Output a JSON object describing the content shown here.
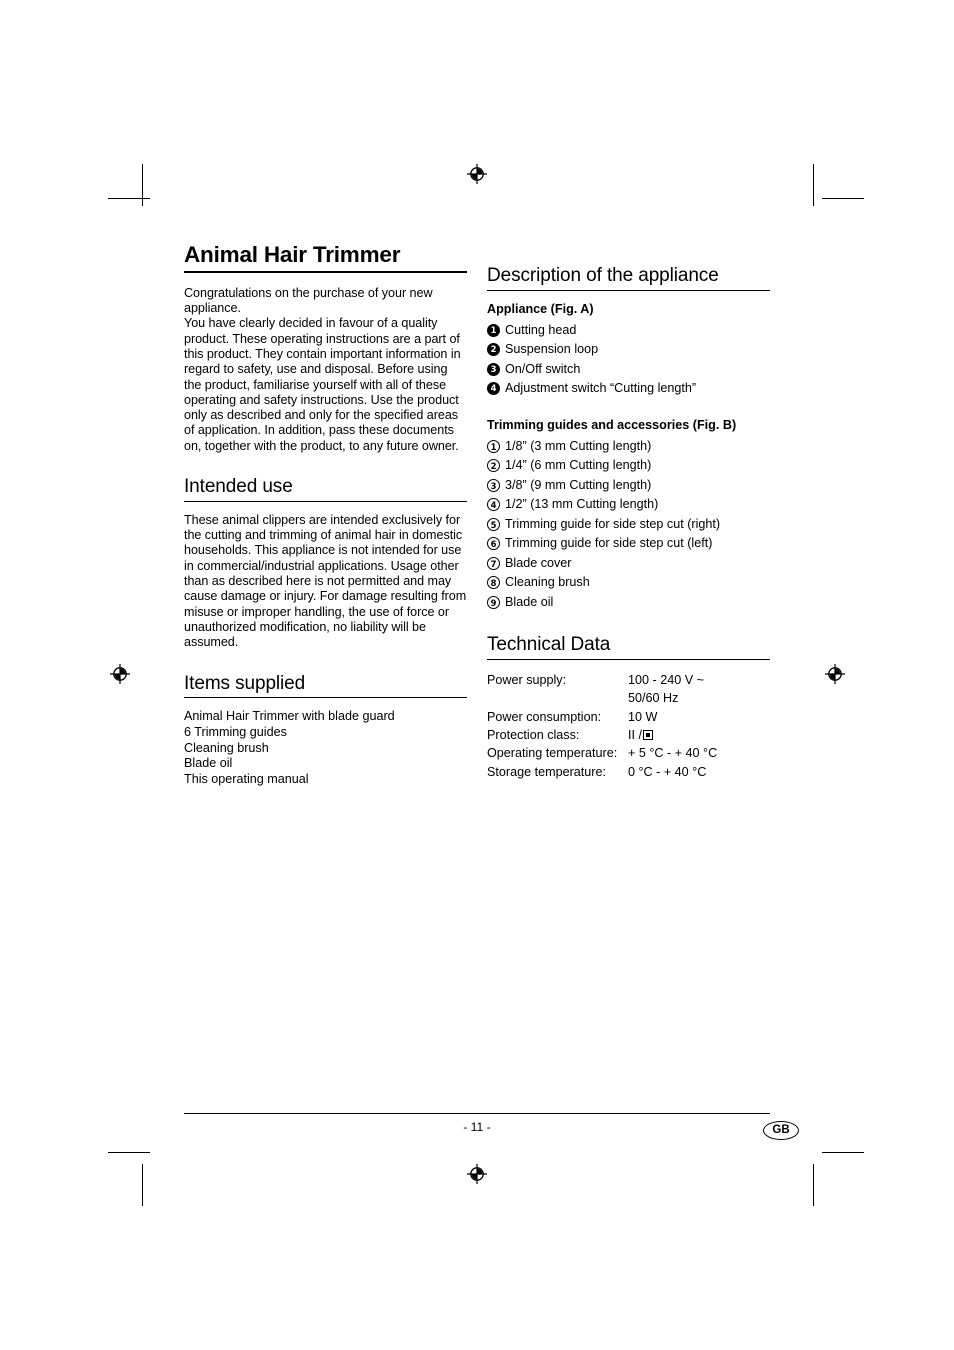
{
  "document": {
    "title": "Animal Hair Trimmer",
    "page_number": "- 11 -",
    "language_badge": "GB"
  },
  "left_column": {
    "intro": "Congratulations on the purchase of your new appliance.\nYou have clearly decided in favour of a quality product. These operating instructions are a part of this product. They contain important information in regard to safety, use and disposal. Before using the product, familiarise yourself with all of these operating and safety instructions. Use the product only as described and only for the specified areas of application. In addition, pass these documents on, together with the product, to any future owner.",
    "intended_use": {
      "heading": "Intended use",
      "text": "These animal clippers are intended exclusively for the cutting and trimming of animal hair in domestic households. This appliance is not intended for use in commercial/industrial applications. Usage other than as described here is not permitted and may cause damage or injury. For damage resulting from misuse or improper handling, the use of force or unauthorized modification, no liability will be assumed."
    },
    "items_supplied": {
      "heading": "Items supplied",
      "items": [
        "Animal Hair Trimmer with blade guard",
        "6 Trimming guides",
        "Cleaning brush",
        "Blade oil",
        "This operating manual"
      ]
    }
  },
  "right_column": {
    "description": {
      "heading": "Description of the appliance",
      "appliance_subhead": "Appliance (Fig. A)",
      "appliance_items": [
        {
          "num": "1",
          "label": "Cutting head"
        },
        {
          "num": "2",
          "label": "Suspension loop"
        },
        {
          "num": "3",
          "label": "On/Off switch"
        },
        {
          "num": "4",
          "label": "Adjustment switch “Cutting length”"
        }
      ],
      "guides_subhead": "Trimming guides and accessories (Fig. B)",
      "guides_items": [
        {
          "num": "1",
          "label": "1/8” (3 mm Cutting length)"
        },
        {
          "num": "2",
          "label": "1/4” (6 mm Cutting length)"
        },
        {
          "num": "3",
          "label": "3/8” (9 mm Cutting length)"
        },
        {
          "num": "4",
          "label": "1/2” (13 mm Cutting length)"
        },
        {
          "num": "5",
          "label": "Trimming guide for side step cut (right)"
        },
        {
          "num": "6",
          "label": "Trimming guide for side step cut (left)"
        },
        {
          "num": "7",
          "label": "Blade cover"
        },
        {
          "num": "8",
          "label": "Cleaning brush"
        },
        {
          "num": "9",
          "label": "Blade oil"
        }
      ]
    },
    "technical_data": {
      "heading": "Technical Data",
      "rows": [
        {
          "label": "Power supply:",
          "value": "100 - 240 V ~"
        },
        {
          "label": "",
          "value": "50/60 Hz"
        },
        {
          "label": "Power consumption:",
          "value": "10 W"
        },
        {
          "label": "Protection class:",
          "value": "II /",
          "symbol": "double-insulation"
        },
        {
          "label": "Operating temperature:",
          "value": "+ 5 °C  -  + 40 °C"
        },
        {
          "label": "Storage temperature:",
          "value": "0 °C  -  + 40 °C"
        }
      ]
    }
  }
}
